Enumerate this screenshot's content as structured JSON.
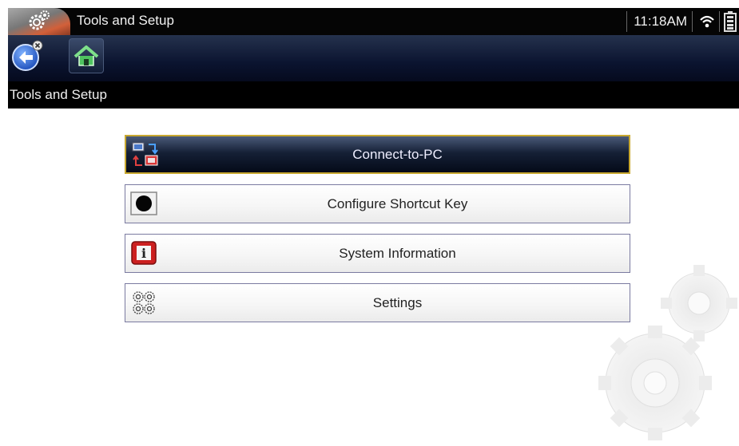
{
  "titlebar": {
    "title": "Tools and Setup",
    "app_icon": "gears-icon",
    "clock": "11:18AM",
    "wifi_icon": "wifi-icon",
    "battery_icon": "battery-icon"
  },
  "toolbar": {
    "back_icon": "back-arrow-icon",
    "home_icon": "home-icon"
  },
  "breadcrumb": {
    "text": "Tools and Setup"
  },
  "menu": {
    "items": [
      {
        "label": "Connect-to-PC",
        "icon": "connect-pc-icon",
        "selected": true
      },
      {
        "label": "Configure Shortcut Key",
        "icon": "shortcut-key-icon",
        "selected": false
      },
      {
        "label": "System Information",
        "icon": "info-icon",
        "selected": false
      },
      {
        "label": "Settings",
        "icon": "settings-icon",
        "selected": false
      }
    ]
  },
  "colors": {
    "selected_border": "#c8a830",
    "toolbar_dark": "#0b1430",
    "item_border": "#7a7aa0"
  }
}
